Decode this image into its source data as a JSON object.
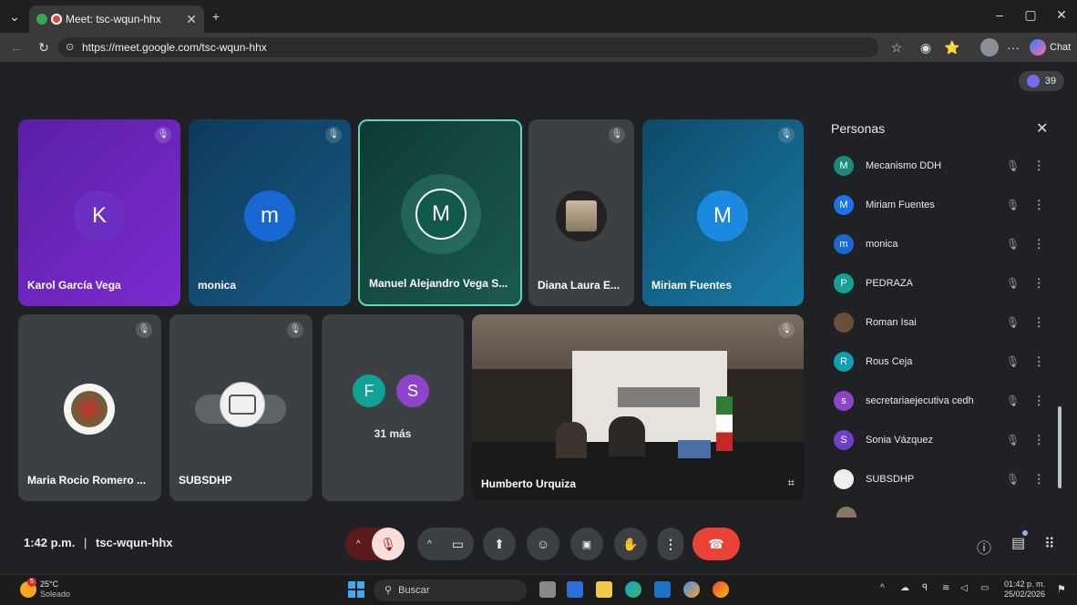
{
  "browser": {
    "tab_title": "Meet: tsc-wqun-hhx",
    "url": "https://meet.google.com/tsc-wqun-hhx",
    "chat_label": "Chat",
    "participant_count": "39"
  },
  "tiles": [
    {
      "name": "Karol García Vega",
      "initial": "K"
    },
    {
      "name": "monica",
      "initial": "m"
    },
    {
      "name": "Manuel Alejandro Vega S...",
      "initial": "M"
    },
    {
      "name": "Diana Laura E..."
    },
    {
      "name": "Miriam Fuentes",
      "initial": "M"
    },
    {
      "name": "Maria Rocio Romero ..."
    },
    {
      "name": "SUBSDHP"
    },
    {
      "more_label": "31 más",
      "initial1": "F",
      "initial2": "S"
    },
    {
      "name": "Humberto Urquiza"
    }
  ],
  "people_panel": {
    "title": "Personas",
    "items": [
      {
        "name": "Mecanismo DDH",
        "initial": "M",
        "color": "#1a8a7a"
      },
      {
        "name": "Miriam Fuentes",
        "initial": "M",
        "color": "#1a73e8"
      },
      {
        "name": "monica",
        "initial": "m",
        "color": "#1967d2"
      },
      {
        "name": "PEDRAZA",
        "initial": "P",
        "color": "#12a195"
      },
      {
        "name": "Roman Isai",
        "initial": "",
        "color": "#6b4f3a"
      },
      {
        "name": "Rous Ceja",
        "initial": "R",
        "color": "#129eaf"
      },
      {
        "name": "secretariaejecutiva cedh",
        "initial": "s",
        "color": "#8e44c9"
      },
      {
        "name": "Sonia Vázquez",
        "initial": "S",
        "color": "#6f3fc7"
      },
      {
        "name": "SUBSDHP",
        "initial": "",
        "color": "#eeeeee"
      }
    ]
  },
  "bottom_bar": {
    "time": "1:42 p.m.",
    "separator": "|",
    "meeting_code": "tsc-wqun-hhx"
  },
  "taskbar": {
    "temperature": "25°C",
    "weather": "Soleado",
    "search_placeholder": "Buscar",
    "clock_time": "01:42 p. m.",
    "clock_date": "25/02/2026",
    "weather_badge": "5"
  },
  "colors": {
    "end_call": "#ea4335",
    "mic_off": "#f9dedc",
    "active_border": "#5fd9b3"
  }
}
